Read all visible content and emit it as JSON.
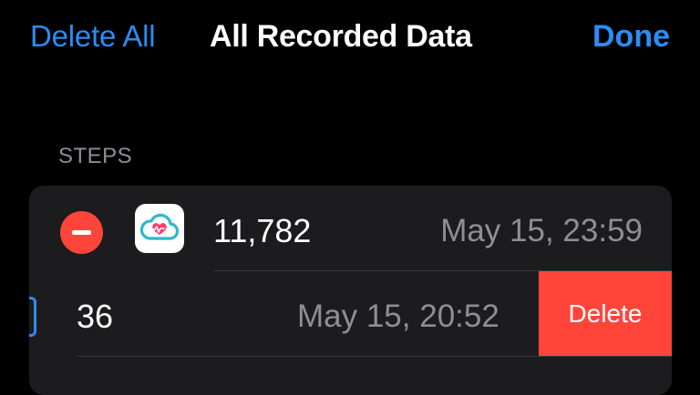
{
  "nav": {
    "left_label": "Delete All",
    "title": "All Recorded Data",
    "right_label": "Done"
  },
  "section": {
    "header": "STEPS"
  },
  "rows": [
    {
      "value": "11,782",
      "date": "May 15, 23:59",
      "source_icon": "health-cloud-heart-icon",
      "edit_control": "minus-circle-icon"
    },
    {
      "value": "36",
      "date": "May 15, 20:52",
      "swipe_action": "Delete"
    }
  ],
  "colors": {
    "background": "#000000",
    "card": "#1c1c1e",
    "accent_blue": "#2b8cf5",
    "destructive_red": "#ff453a",
    "secondary_text": "#8e8e93"
  }
}
